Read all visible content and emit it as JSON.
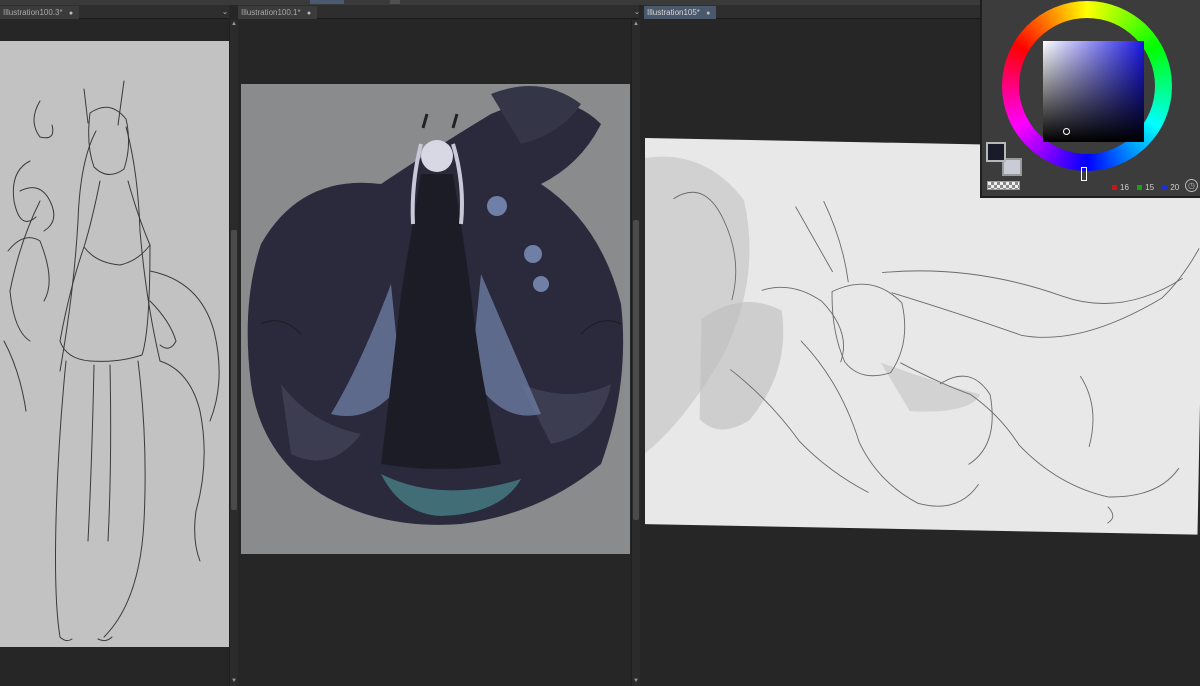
{
  "app": {
    "accent": "#4a586c",
    "background": "#262626"
  },
  "documents": [
    {
      "tab_label": "Illustration100.3*",
      "close_glyph": "●",
      "active": false,
      "canvas_bg": "#c2c2c2"
    },
    {
      "tab_label": "Illustration100.1*",
      "close_glyph": "●",
      "active": false,
      "canvas_bg": "#8a8b8d"
    },
    {
      "tab_label": "Illustration105*",
      "close_glyph": "●",
      "active": true,
      "canvas_bg": "#e8e8e8"
    }
  ],
  "pane_menu_glyph": "⌄",
  "scroll_up_glyph": "▲",
  "scroll_down_glyph": "▼",
  "color_panel": {
    "main_color": "#1a1b2a",
    "sub_color": "#c9cbd6",
    "hue_color": "#1a18e6",
    "values": [
      {
        "channel_color": "#c01818",
        "value": "16"
      },
      {
        "channel_color": "#18a018",
        "value": "15"
      },
      {
        "channel_color": "#2030d0",
        "value": "20"
      }
    ],
    "menu_glyph": "◷"
  }
}
